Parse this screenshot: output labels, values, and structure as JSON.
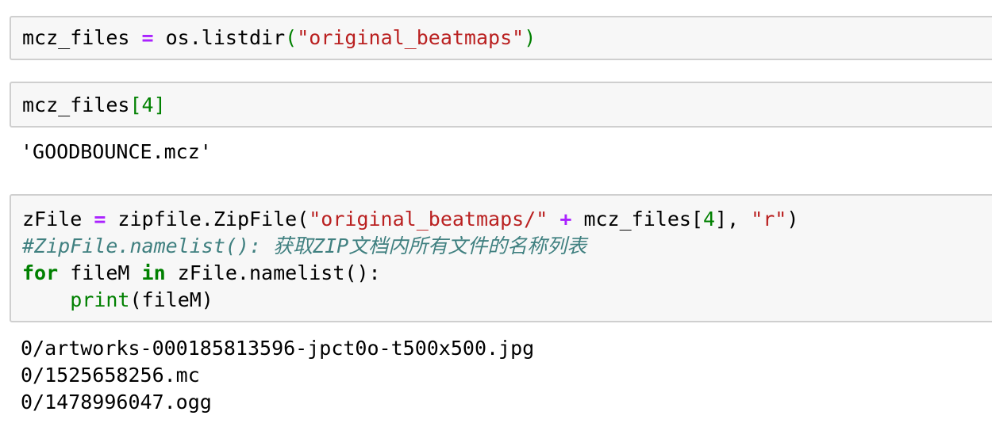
{
  "cells": [
    {
      "lines": [
        [
          "mcz_files ",
          "=",
          " os.listdir",
          "(",
          "\"original_beatmaps\"",
          ")"
        ]
      ]
    },
    {
      "lines": [
        [
          "mcz_files",
          "[",
          "4",
          "]"
        ]
      ],
      "output": [
        "'GOODBOUNCE.mcz'"
      ]
    },
    {
      "lines": [
        [
          "zFile ",
          "=",
          " zipfile.ZipFile(",
          "\"original_beatmaps/\"",
          " ",
          "+",
          " mcz_files[",
          "4",
          "], ",
          "\"r\"",
          ")"
        ],
        [
          "#ZipFile.namelist(): 获取ZIP文档内所有文件的名称列表"
        ],
        [
          "for",
          " fileM ",
          "in",
          " zFile.namelist():"
        ],
        [
          "    ",
          "print",
          "(fileM)"
        ]
      ],
      "output": [
        "0/artworks-000185813596-jpct0o-t500x500.jpg",
        "0/1525658256.mc",
        "0/1478996047.ogg"
      ]
    }
  ],
  "colors": {
    "operator": "#aa22ff",
    "string": "#ba2121",
    "number": "#008000",
    "keyword": "#008000",
    "comment": "#408080",
    "cell_background": "#f7f7f7",
    "cell_border": "#cfcfcf"
  }
}
